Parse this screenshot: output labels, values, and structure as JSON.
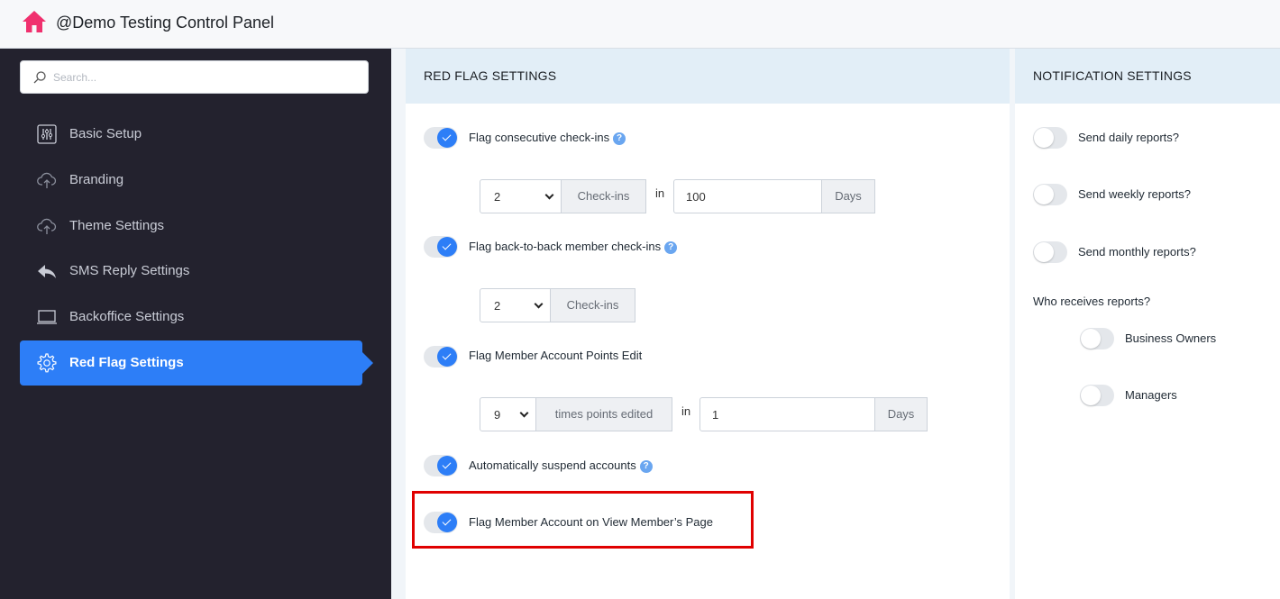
{
  "header": {
    "title": "@Demo Testing Control Panel",
    "home_icon": "home-icon",
    "home_color": "#f0306e"
  },
  "search": {
    "placeholder": "Search..."
  },
  "sidebar": {
    "items": [
      {
        "label": "Basic Setup",
        "icon": "sliders-icon"
      },
      {
        "label": "Branding",
        "icon": "cloud-upload-icon"
      },
      {
        "label": "Theme Settings",
        "icon": "cloud-upload-icon"
      },
      {
        "label": "SMS Reply Settings",
        "icon": "reply-icon"
      },
      {
        "label": "Backoffice Settings",
        "icon": "laptop-icon"
      },
      {
        "label": "Red Flag Settings",
        "icon": "gear-icon",
        "active": true
      }
    ]
  },
  "red_flag": {
    "title": "RED FLAG SETTINGS",
    "consecutive": {
      "label": "Flag consecutive check-ins",
      "enabled": true,
      "count": "2",
      "count_unit": "Check-ins",
      "in_word": "in",
      "days": "100",
      "days_unit": "Days"
    },
    "back_to_back": {
      "label": "Flag back-to-back member check-ins",
      "enabled": true,
      "count": "2",
      "count_unit": "Check-ins"
    },
    "points_edit": {
      "label": "Flag Member Account Points Edit",
      "enabled": true,
      "count": "9",
      "count_unit": "times points edited",
      "in_word": "in",
      "days": "1",
      "days_unit": "Days"
    },
    "suspend": {
      "label": "Automatically suspend accounts",
      "enabled": true
    },
    "view_page": {
      "label": "Flag Member Account on View Member’s Page",
      "enabled": true
    },
    "help_glyph": "?"
  },
  "notifications": {
    "title": "NOTIFICATION SETTINGS",
    "daily": {
      "label": "Send daily reports?",
      "enabled": false
    },
    "weekly": {
      "label": "Send weekly reports?",
      "enabled": false
    },
    "monthly": {
      "label": "Send monthly reports?",
      "enabled": false
    },
    "receivers_heading": "Who receives reports?",
    "owners": {
      "label": "Business Owners",
      "enabled": false
    },
    "managers": {
      "label": "Managers",
      "enabled": false
    }
  },
  "colors": {
    "accent": "#2d7ef7",
    "sidebar_bg": "#23222e",
    "highlight": "#e00000"
  }
}
